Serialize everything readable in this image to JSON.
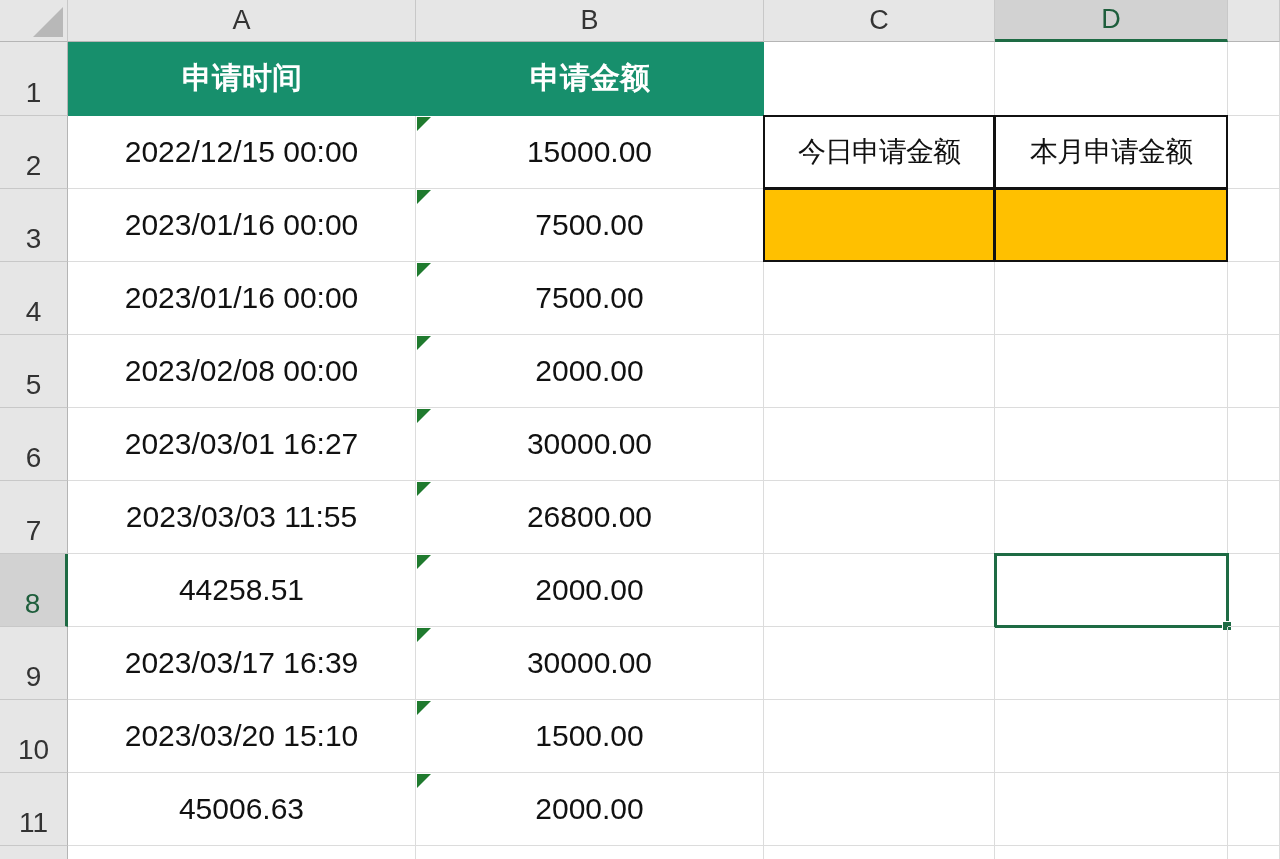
{
  "columns": [
    {
      "label": "A",
      "selected": false
    },
    {
      "label": "B",
      "selected": false
    },
    {
      "label": "C",
      "selected": false
    },
    {
      "label": "D",
      "selected": true
    }
  ],
  "rows": [
    {
      "number": "1",
      "selected": false,
      "cells": [
        {
          "kind": "header",
          "text": "申请时间",
          "selected": false,
          "error_flag": false
        },
        {
          "kind": "header",
          "text": "申请金额",
          "selected": false,
          "error_flag": false
        },
        {
          "kind": "empty",
          "selected": false
        },
        {
          "kind": "empty",
          "selected": false
        }
      ]
    },
    {
      "number": "2",
      "selected": false,
      "cells": [
        {
          "kind": "data",
          "text": "2022/12/15 00:00",
          "selected": false,
          "error_flag": false
        },
        {
          "kind": "data",
          "text": "15000.00",
          "selected": false,
          "error_flag": true
        },
        {
          "kind": "label",
          "text": "今日申请金额",
          "selected": false,
          "error_flag": false
        },
        {
          "kind": "label",
          "text": "本月申请金额",
          "selected": false,
          "error_flag": false
        }
      ]
    },
    {
      "number": "3",
      "selected": false,
      "cells": [
        {
          "kind": "data",
          "text": "2023/01/16 00:00",
          "selected": false,
          "error_flag": false
        },
        {
          "kind": "data",
          "text": "7500.00",
          "selected": false,
          "error_flag": true
        },
        {
          "kind": "input",
          "selected": false,
          "error_flag": false
        },
        {
          "kind": "input",
          "selected": false,
          "error_flag": false
        }
      ]
    },
    {
      "number": "4",
      "selected": false,
      "cells": [
        {
          "kind": "data",
          "text": "2023/01/16 00:00",
          "selected": false,
          "error_flag": false
        },
        {
          "kind": "data",
          "text": "7500.00",
          "selected": false,
          "error_flag": true
        },
        {
          "kind": "empty",
          "selected": false
        },
        {
          "kind": "empty",
          "selected": false
        }
      ]
    },
    {
      "number": "5",
      "selected": false,
      "cells": [
        {
          "kind": "data",
          "text": "2023/02/08 00:00",
          "selected": false,
          "error_flag": false
        },
        {
          "kind": "data",
          "text": "2000.00",
          "selected": false,
          "error_flag": true
        },
        {
          "kind": "empty",
          "selected": false
        },
        {
          "kind": "empty",
          "selected": false
        }
      ]
    },
    {
      "number": "6",
      "selected": false,
      "cells": [
        {
          "kind": "data",
          "text": "2023/03/01 16:27",
          "selected": false,
          "error_flag": false
        },
        {
          "kind": "data",
          "text": "30000.00",
          "selected": false,
          "error_flag": true
        },
        {
          "kind": "empty",
          "selected": false
        },
        {
          "kind": "empty",
          "selected": false
        }
      ]
    },
    {
      "number": "7",
      "selected": false,
      "cells": [
        {
          "kind": "data",
          "text": "2023/03/03 11:55",
          "selected": false,
          "error_flag": false
        },
        {
          "kind": "data",
          "text": "26800.00",
          "selected": false,
          "error_flag": true
        },
        {
          "kind": "empty",
          "selected": false
        },
        {
          "kind": "empty",
          "selected": false
        }
      ]
    },
    {
      "number": "8",
      "selected": true,
      "cells": [
        {
          "kind": "data",
          "text": "44258.51",
          "selected": false,
          "error_flag": false
        },
        {
          "kind": "data",
          "text": "2000.00",
          "selected": false,
          "error_flag": true
        },
        {
          "kind": "empty",
          "selected": false
        },
        {
          "kind": "empty",
          "selected": true
        }
      ]
    },
    {
      "number": "9",
      "selected": false,
      "cells": [
        {
          "kind": "data",
          "text": "2023/03/17 16:39",
          "selected": false,
          "error_flag": false
        },
        {
          "kind": "data",
          "text": "30000.00",
          "selected": false,
          "error_flag": true
        },
        {
          "kind": "empty",
          "selected": false
        },
        {
          "kind": "empty",
          "selected": false
        }
      ]
    },
    {
      "number": "10",
      "selected": false,
      "cells": [
        {
          "kind": "data",
          "text": "2023/03/20 15:10",
          "selected": false,
          "error_flag": false
        },
        {
          "kind": "data",
          "text": "1500.00",
          "selected": false,
          "error_flag": true
        },
        {
          "kind": "empty",
          "selected": false
        },
        {
          "kind": "empty",
          "selected": false
        }
      ]
    },
    {
      "number": "11",
      "selected": false,
      "cells": [
        {
          "kind": "data",
          "text": "45006.63",
          "selected": false,
          "error_flag": false
        },
        {
          "kind": "data",
          "text": "2000.00",
          "selected": false,
          "error_flag": true
        },
        {
          "kind": "empty",
          "selected": false
        },
        {
          "kind": "empty",
          "selected": false
        }
      ]
    }
  ]
}
